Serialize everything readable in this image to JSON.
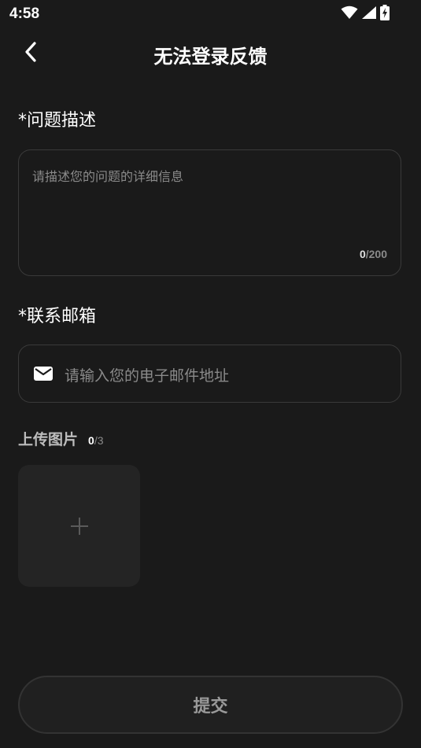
{
  "status_bar": {
    "time": "4:58",
    "icons": [
      "wifi-icon",
      "signal-icon",
      "battery-charging-icon"
    ]
  },
  "header": {
    "title": "无法登录反馈",
    "back_icon": "chevron-left-icon"
  },
  "description": {
    "label": "*问题描述",
    "placeholder": "请描述您的问题的详细信息",
    "counter_current": "0",
    "counter_max": "/200"
  },
  "email": {
    "label": "*联系邮箱",
    "placeholder": "请输入您的电子邮件地址",
    "icon": "mail-icon"
  },
  "upload": {
    "label": "上传图片",
    "count_current": "0",
    "count_max": "/3",
    "add_icon": "plus-icon"
  },
  "submit": {
    "label": "提交"
  },
  "colors": {
    "background": "#1a1a1a",
    "border": "#3a3a3a",
    "placeholder": "#8a8a8a",
    "tile": "#242424"
  }
}
